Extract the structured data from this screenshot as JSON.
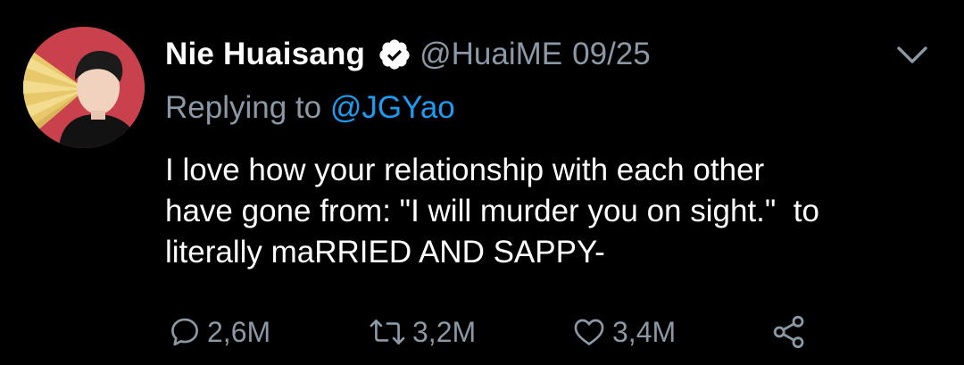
{
  "tweet": {
    "author": {
      "display_name": "Nie Huaisang",
      "verified": true,
      "handle": "@HuaiME",
      "avatar_icon": "avatar-photo"
    },
    "date": "09/25",
    "replying_to": {
      "prefix": "Replying to ",
      "mention": "@JGYao"
    },
    "text": "I love how your relationship with each other\nhave gone from: \"I will murder you on sight.\"  to\nliterally maRRIED AND SAPPY-",
    "actions": {
      "replies": "2,6M",
      "retweets": "3,2M",
      "likes": "3,4M"
    },
    "menu_icon": "chevron-down-icon"
  },
  "colors": {
    "background": "#000000",
    "primary_text": "#ffffff",
    "secondary_text": "#8b98a5",
    "link": "#1d9bf0"
  }
}
